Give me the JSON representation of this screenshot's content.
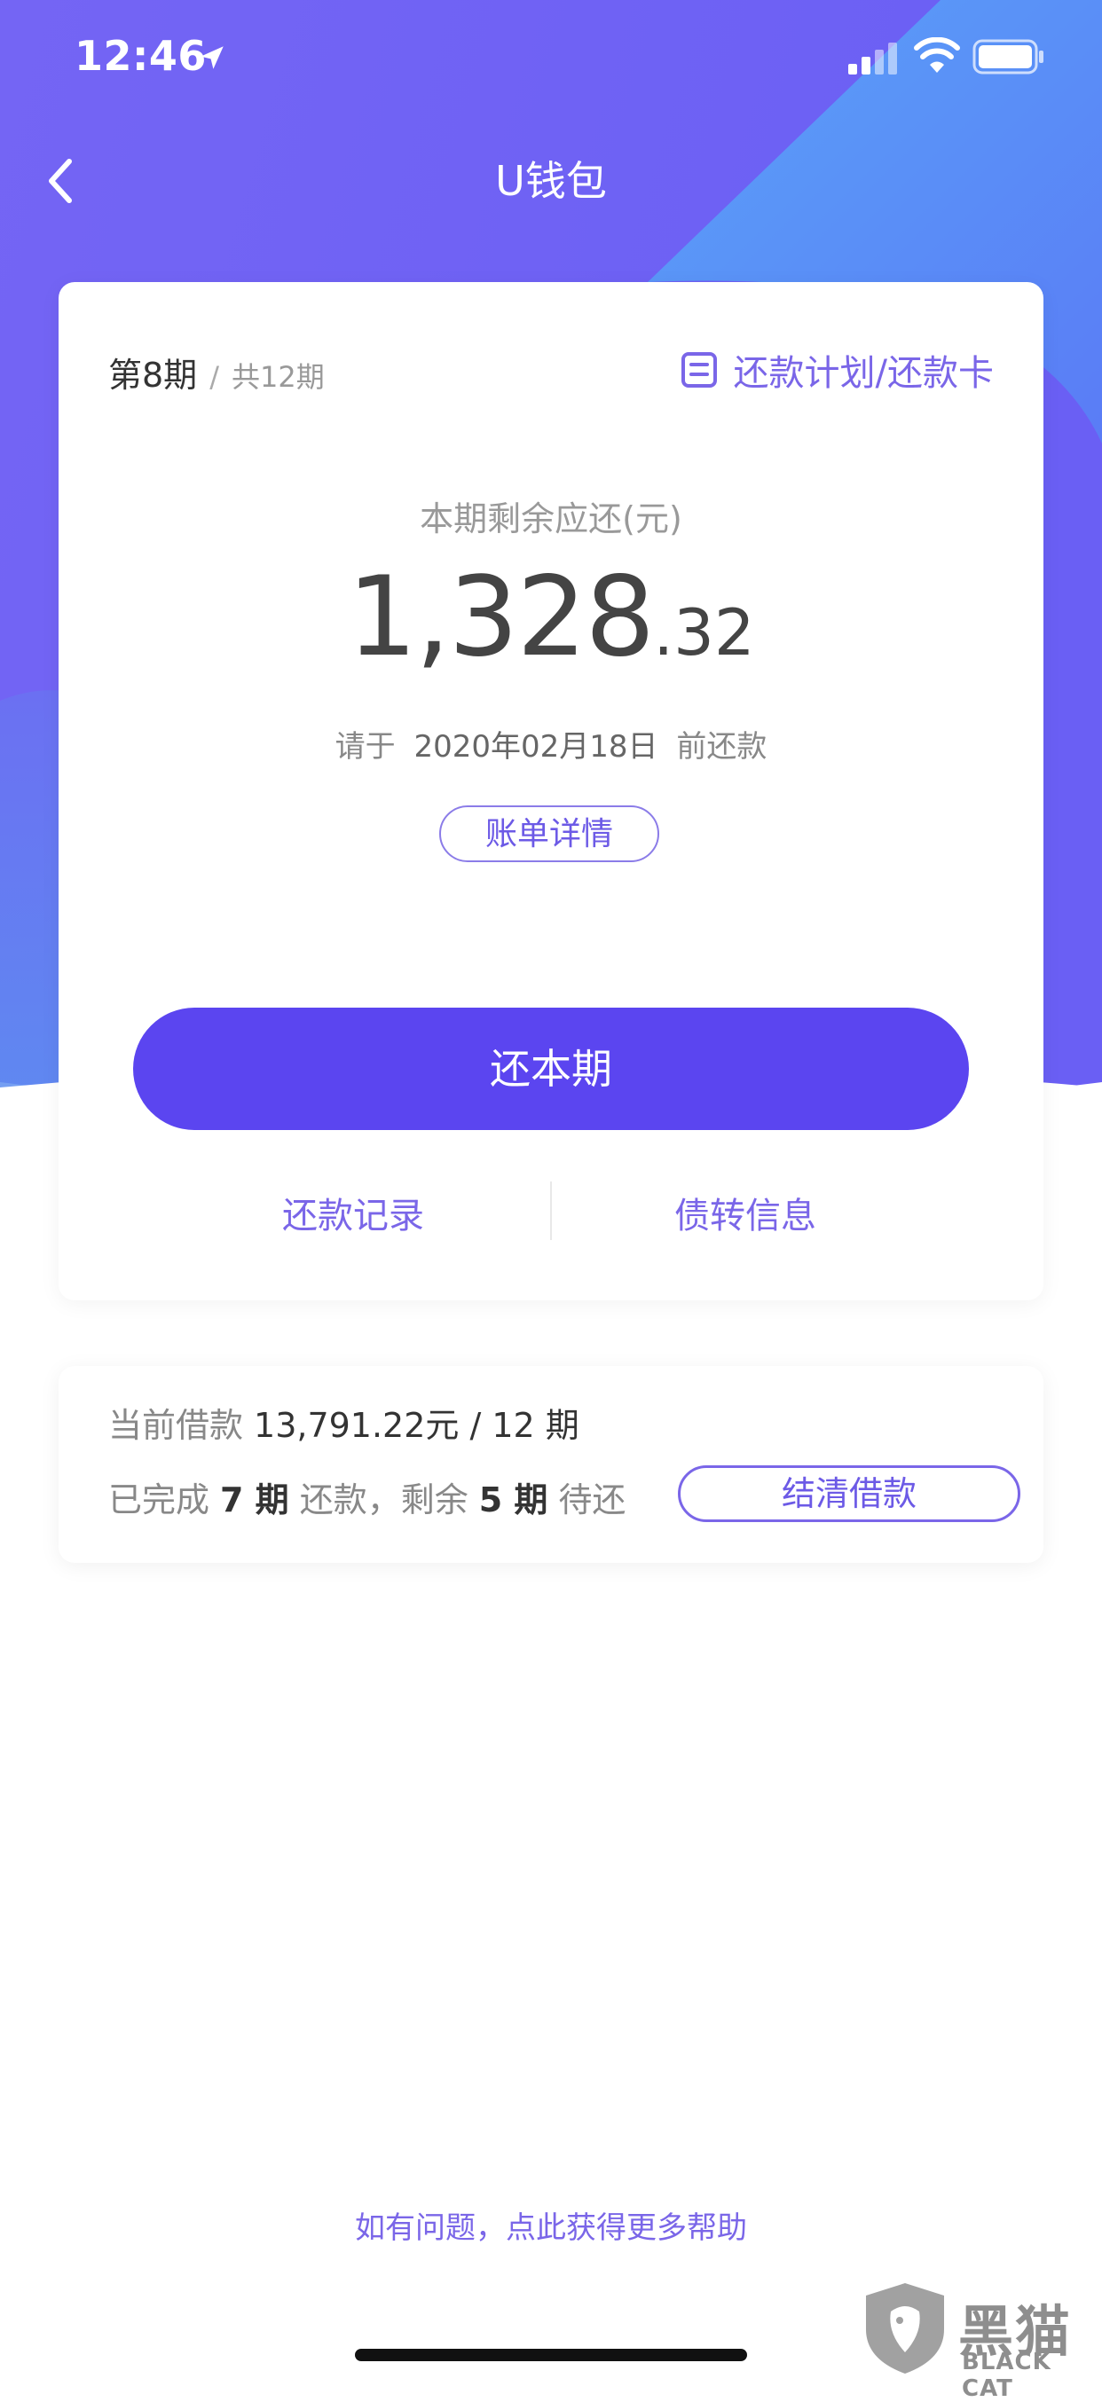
{
  "status_bar": {
    "time": "12:46",
    "icons": [
      "location-arrow-icon",
      "signal-icon",
      "wifi-icon",
      "battery-icon"
    ]
  },
  "nav": {
    "title": "U钱包",
    "back_icon": "chevron-left-icon"
  },
  "card": {
    "period_current": "第8期",
    "period_separator": "/",
    "period_total": "共12期",
    "plan_link": "还款计划/还款卡",
    "plan_icon": "document-icon",
    "remain_label": "本期剩余应还(元)",
    "amount_integer": "1,328",
    "amount_decimal": ".32",
    "due_prefix": "请于",
    "due_date": "2020年02月18日",
    "due_suffix": "前还款",
    "bill_detail_label": "账单详情",
    "repay_label": "还本期",
    "link_record": "还款记录",
    "link_transfer": "债转信息"
  },
  "loan": {
    "current_label": "当前借款",
    "current_value": "13,791.22元 / 12 期",
    "completed_prefix": "已完成",
    "completed_count": "7 期",
    "completed_mid": "还款，剩余",
    "remaining_count": "5 期",
    "remaining_suffix": "待还",
    "settle_label": "结清借款"
  },
  "help_link": "如有问题，点此获得更多帮助",
  "watermark": {
    "title": "黑猫",
    "subtitle": "BLACK CAT"
  },
  "colors": {
    "accent": "#5b45f0",
    "link": "#7a66e8",
    "hero_start": "#6f5cf5",
    "hero_end": "#4f8ff7"
  }
}
